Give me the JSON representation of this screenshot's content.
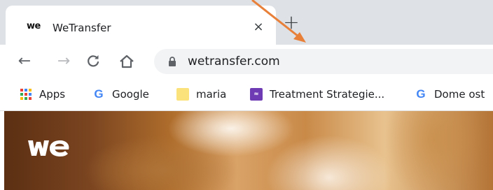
{
  "tab": {
    "favicon_text": "we",
    "title": "WeTransfer",
    "close_glyph": "×"
  },
  "new_tab_glyph": "+",
  "toolbar": {
    "back_glyph": "←",
    "forward_glyph": "→",
    "reload_glyph": "↻",
    "home_glyph": "⌂"
  },
  "omnibox": {
    "url": "wetransfer.com"
  },
  "bookmarks": [
    {
      "label": "Apps",
      "icon": "apps-grid-icon"
    },
    {
      "label": "Google",
      "icon": "google-icon"
    },
    {
      "label": "maria",
      "icon": "folder-icon"
    },
    {
      "label": "Treatment Strategie...",
      "icon": "bookmark-favicon-purple"
    },
    {
      "label": "Dome ost",
      "icon": "google-icon"
    }
  ],
  "page": {
    "logo_text": "we"
  },
  "colors": {
    "tabstrip": "#dee1e6",
    "omnibox": "#f1f3f4",
    "annotation_arrow": "#e8803a"
  }
}
